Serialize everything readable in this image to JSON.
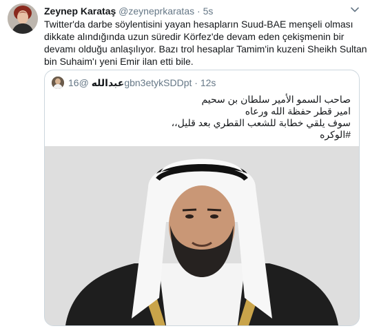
{
  "tweet": {
    "author_name": "Zeynep Karataş",
    "author_handle": "@zeyneprkaratas",
    "separator": "·",
    "time": "5s",
    "text_lines": [
      "Twitter'da darbe söylentisini yayan hesapların Suud-BAE menşeli olması",
      "dikkate alındığında uzun süredir Körfez'de devam eden çekişmenin bir",
      "devamı olduğu anlaşılıyor. Bazı trol hesaplar  Tamim'in kuzeni  Sheikh Sultan",
      "bin Suhaim'ı yeni Emir ilan etti bile."
    ],
    "menu_icon": "chevron-down-icon"
  },
  "quoted_tweet": {
    "author_name": "عبدالله",
    "author_handle": "@16gbn3etykSDDpt",
    "separator": "·",
    "time": "12s",
    "text_lines": [
      "صاحب السمو الأمير سلطان بن سحيم",
      "امير قطر حفظة الله ورعاه",
      "سوف يلقي خطابة للشعب القطري بعد قليل،،",
      "#الوكره"
    ]
  },
  "colors": {
    "primary_text": "#14171a",
    "secondary_text": "#657786",
    "border": "#ccd6dd",
    "background": "#ffffff"
  }
}
